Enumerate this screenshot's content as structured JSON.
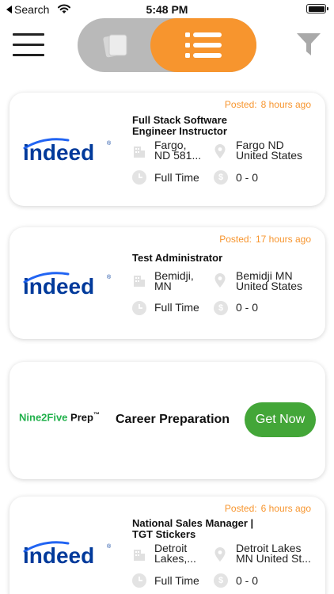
{
  "status_bar": {
    "back_label": "Search",
    "time": "5:48 PM"
  },
  "header": {
    "menu_icon": "hamburger-menu-icon",
    "card_view_icon": "cards-icon",
    "list_view_icon": "list-icon",
    "filter_icon": "funnel-filter-icon",
    "active_view": "list"
  },
  "colors": {
    "accent": "#f7952e",
    "toggle_bg": "#b9b9b9",
    "promo_button": "#43a638",
    "promo_logo": "#22b14c",
    "indeed_blue": "#2164f3"
  },
  "jobs": [
    {
      "posted_label": "Posted:",
      "posted_age": "8 hours ago",
      "company_logo": "indeed",
      "title_line1": "Full Stack Software",
      "title_line2": "Engineer Instructor",
      "address_line1": "Fargo,",
      "address_line2": "ND 581...",
      "location_line1": "Fargo ND",
      "location_line2": "United States",
      "job_type": "Full Time",
      "salary": "0 - 0"
    },
    {
      "posted_label": "Posted:",
      "posted_age": "17 hours ago",
      "company_logo": "indeed",
      "title_line1": "Test Administrator",
      "title_line2": "",
      "address_line1": "Bemidji,",
      "address_line2": "MN",
      "location_line1": "Bemidji MN",
      "location_line2": "United States",
      "job_type": "Full Time",
      "salary": "0 - 0"
    },
    {
      "posted_label": "Posted:",
      "posted_age": "6 hours ago",
      "company_logo": "indeed",
      "title_line1": "National Sales Manager |",
      "title_line2": "TGT Stickers",
      "address_line1": "Detroit",
      "address_line2": "Lakes,...",
      "location_line1": "Detroit Lakes",
      "location_line2": "MN United St...",
      "job_type": "Full Time",
      "salary": "0 - 0"
    }
  ],
  "promo": {
    "logo_green": "Nine2Five",
    "logo_black": "Prep",
    "logo_tm": "™",
    "text": "Career Preparation",
    "button_label": "Get Now"
  },
  "indeed_logo_text": "indeed",
  "indeed_registered": "®"
}
